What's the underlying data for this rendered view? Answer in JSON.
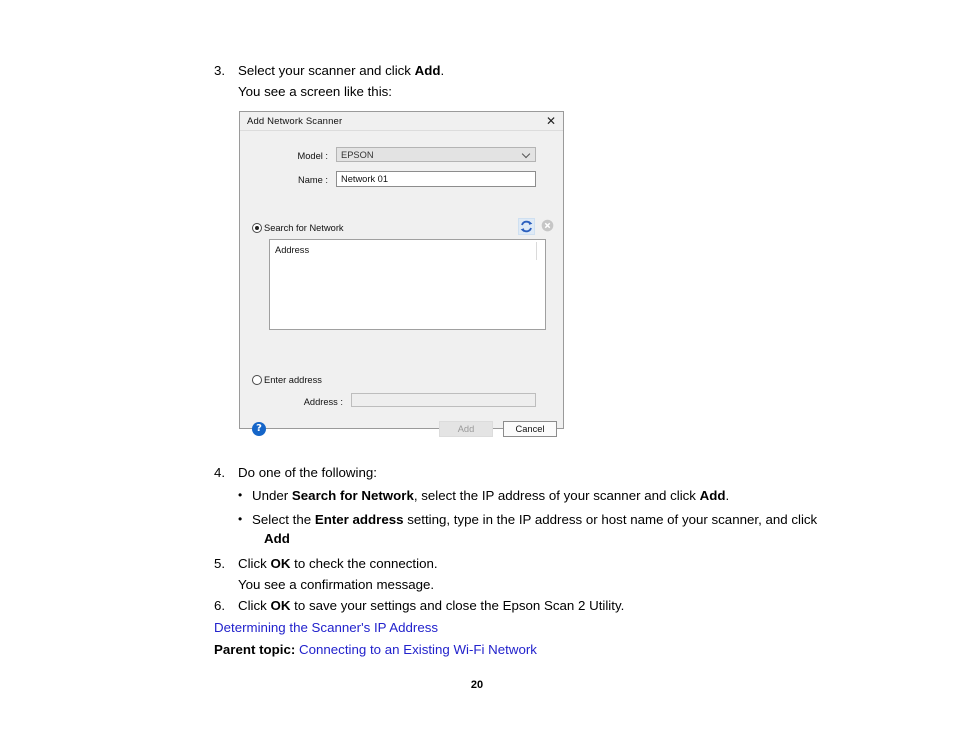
{
  "document": {
    "page_number": "20",
    "steps": [
      {
        "number": "3.",
        "text_before": "Select your scanner and click ",
        "bold": "Add",
        "text_after": ".",
        "sub_line": "You see a screen like this:"
      },
      {
        "number": "4.",
        "text": "Do one of the following:"
      },
      {
        "number": "5.",
        "text_before": "Click ",
        "bold": "OK",
        "text_after": " to check the connection.",
        "sub_line": "You see a confirmation message."
      },
      {
        "number": "6.",
        "text_before": "Click ",
        "bold": "OK",
        "text_after": " to save your settings and close the Epson Scan 2 Utility."
      }
    ],
    "bullets": [
      {
        "dot": "•",
        "part1": "Under ",
        "bold1": "Search for Network",
        "part2": ", select the IP address of your scanner and click ",
        "bold2": "Add",
        "part3": "."
      },
      {
        "dot": "•",
        "part1": "Select the ",
        "bold1": "Enter address",
        "part2": " setting, type in the IP address or host name of your scanner, and click ",
        "bold2": "Add",
        "part3": "."
      }
    ],
    "links": {
      "determining_ip": "Determining the Scanner's IP Address",
      "parent_topic_label": "Parent topic:",
      "parent_topic_link": "Connecting to an Existing Wi-Fi Network",
      "link_color": "#2222cc"
    }
  },
  "dialog": {
    "title": "Add Network Scanner",
    "close_glyph": "✕",
    "model": {
      "label": "Model :",
      "value": "EPSON"
    },
    "name": {
      "label": "Name :",
      "value": "Network 01"
    },
    "search_option": {
      "label": "Search for Network",
      "selected": true
    },
    "list": {
      "column_header": "Address",
      "rows": []
    },
    "enter_address_option": {
      "label": "Enter address",
      "selected": false
    },
    "address_field": {
      "label": "Address :",
      "value": "",
      "placeholder": ""
    },
    "help_glyph": "?",
    "buttons": {
      "add": "Add",
      "cancel": "Cancel"
    }
  }
}
